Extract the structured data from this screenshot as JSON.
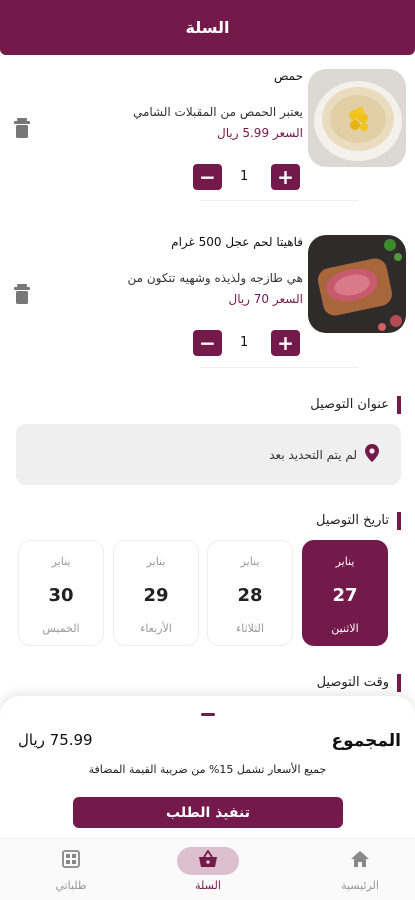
{
  "header": {
    "title": "السلة"
  },
  "cart": {
    "items": [
      {
        "name": "حمص",
        "description": "يعتبر الحمص من المقبلات الشامي",
        "price": "السعر 5.99 ريال",
        "quantity": "1"
      },
      {
        "name": "فاهيتا لحم عجل 500 غرام",
        "description": "هي طازجه ولذيذه وشهيه تتكون من",
        "price": "السعر 70 ريال",
        "quantity": "1"
      }
    ]
  },
  "delivery_address": {
    "title": "عنوان التوصيل",
    "value": "لم يتم التحديد بعد"
  },
  "delivery_date": {
    "title": "تاريخ التوصيل",
    "days": [
      {
        "month": "يناير",
        "day": "27",
        "weekday": "الاثنين",
        "selected": true
      },
      {
        "month": "يناير",
        "day": "28",
        "weekday": "الثلاثاء",
        "selected": false
      },
      {
        "month": "يناير",
        "day": "29",
        "weekday": "الأربعاء",
        "selected": false
      },
      {
        "month": "يناير",
        "day": "30",
        "weekday": "الخميس",
        "selected": false
      }
    ]
  },
  "delivery_time": {
    "title": "وقت التوصيل"
  },
  "summary": {
    "total_label": "المجموع",
    "total_value": "75.99 ريال",
    "vat_note": "جميع الأسعار تشمل 15% من ضريبة القيمة المضافة",
    "checkout_label": "تنفيذ الطلب"
  },
  "bottom_nav": {
    "items": [
      {
        "label": "الرئيسية",
        "icon": "home-icon"
      },
      {
        "label": "السلة",
        "icon": "basket-icon"
      },
      {
        "label": "طلباتي",
        "icon": "orders-icon"
      }
    ]
  },
  "colors": {
    "accent": "#741a4a",
    "accent_light": "#dcc0d0"
  }
}
